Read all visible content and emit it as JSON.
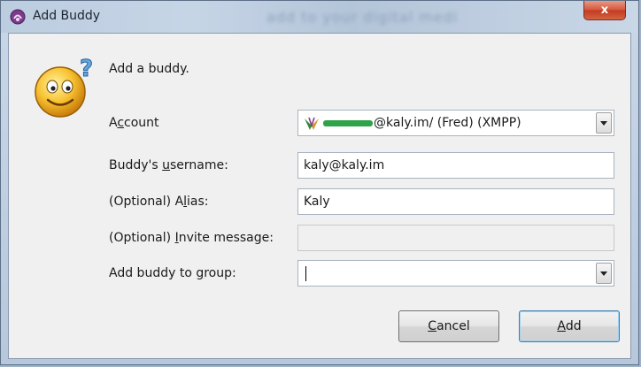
{
  "window": {
    "title": "Add Buddy",
    "background_title": "add to your digital medi",
    "close_glyph": "x"
  },
  "dialog": {
    "prompt": "Add a buddy.",
    "icon": "smiley-question-icon"
  },
  "labels": {
    "account": {
      "pre": "A",
      "ul": "c",
      "post": "count"
    },
    "username": {
      "pre": "Buddy's ",
      "ul": "u",
      "post": "sername:"
    },
    "alias": {
      "pre": "(Optional) A",
      "ul": "l",
      "post": "ias:"
    },
    "invite": {
      "pre": "(Optional) ",
      "ul": "I",
      "post": "nvite message:"
    },
    "group": {
      "pre": "Add buddy to ",
      "ul": "g",
      "post": "roup:"
    }
  },
  "fields": {
    "account_value": "@kaly.im/ (Fred) (XMPP)",
    "account_icon": "xmpp-icon",
    "username_value": "kaly@kaly.im",
    "alias_value": "Kaly",
    "invite_value": "",
    "group_value": ""
  },
  "buttons": {
    "cancel": {
      "ul": "C",
      "post": "ancel"
    },
    "add": {
      "ul": "A",
      "post": "dd"
    }
  },
  "colors": {
    "close_red": "#c33a22",
    "default_button_border": "#3c7fb1"
  }
}
